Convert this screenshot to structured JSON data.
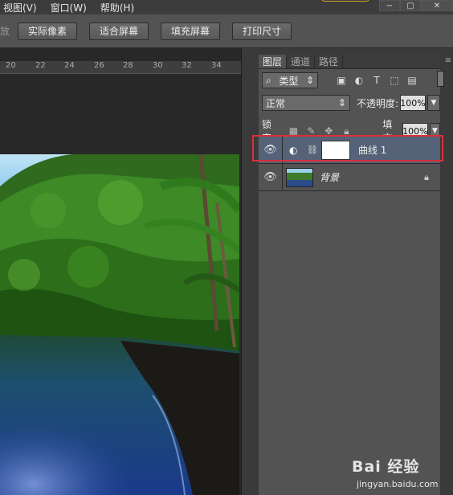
{
  "menu": {
    "items": [
      "视图(V)",
      "窗口(W)",
      "帮助(H)"
    ]
  },
  "window_controls": [
    "▭",
    "−",
    "▢",
    "✕"
  ],
  "options_bar": {
    "prefix": "缩放",
    "buttons": [
      "实际像素",
      "适合屏幕",
      "填充屏幕",
      "打印尺寸"
    ]
  },
  "ruler": {
    "ticks": [
      "20",
      "22",
      "24",
      "26",
      "28",
      "30",
      "32",
      "34"
    ]
  },
  "layers_panel": {
    "tabs": [
      "图层",
      "通道",
      "路径"
    ],
    "filter_label": "类型",
    "filter_icons": [
      "image-filter-icon",
      "adjustment-filter-icon",
      "type-filter-icon",
      "shape-filter-icon",
      "smart-object-filter-icon"
    ],
    "blend_mode": "正常",
    "opacity_label": "不透明度:",
    "opacity_value": "100%",
    "lock_label": "锁定:",
    "fill_label": "填充:",
    "fill_value": "100%",
    "layers": [
      {
        "name": "曲线 1",
        "type": "adjustment",
        "visible": true,
        "selected": true
      },
      {
        "name": "背景",
        "type": "image",
        "visible": true,
        "locked": true
      }
    ]
  },
  "watermark": {
    "line1": "Bai 经验",
    "line2": "jingyan.baidu.com"
  },
  "colors": {
    "highlight": "#d9303a",
    "selected_layer": "#556277"
  }
}
